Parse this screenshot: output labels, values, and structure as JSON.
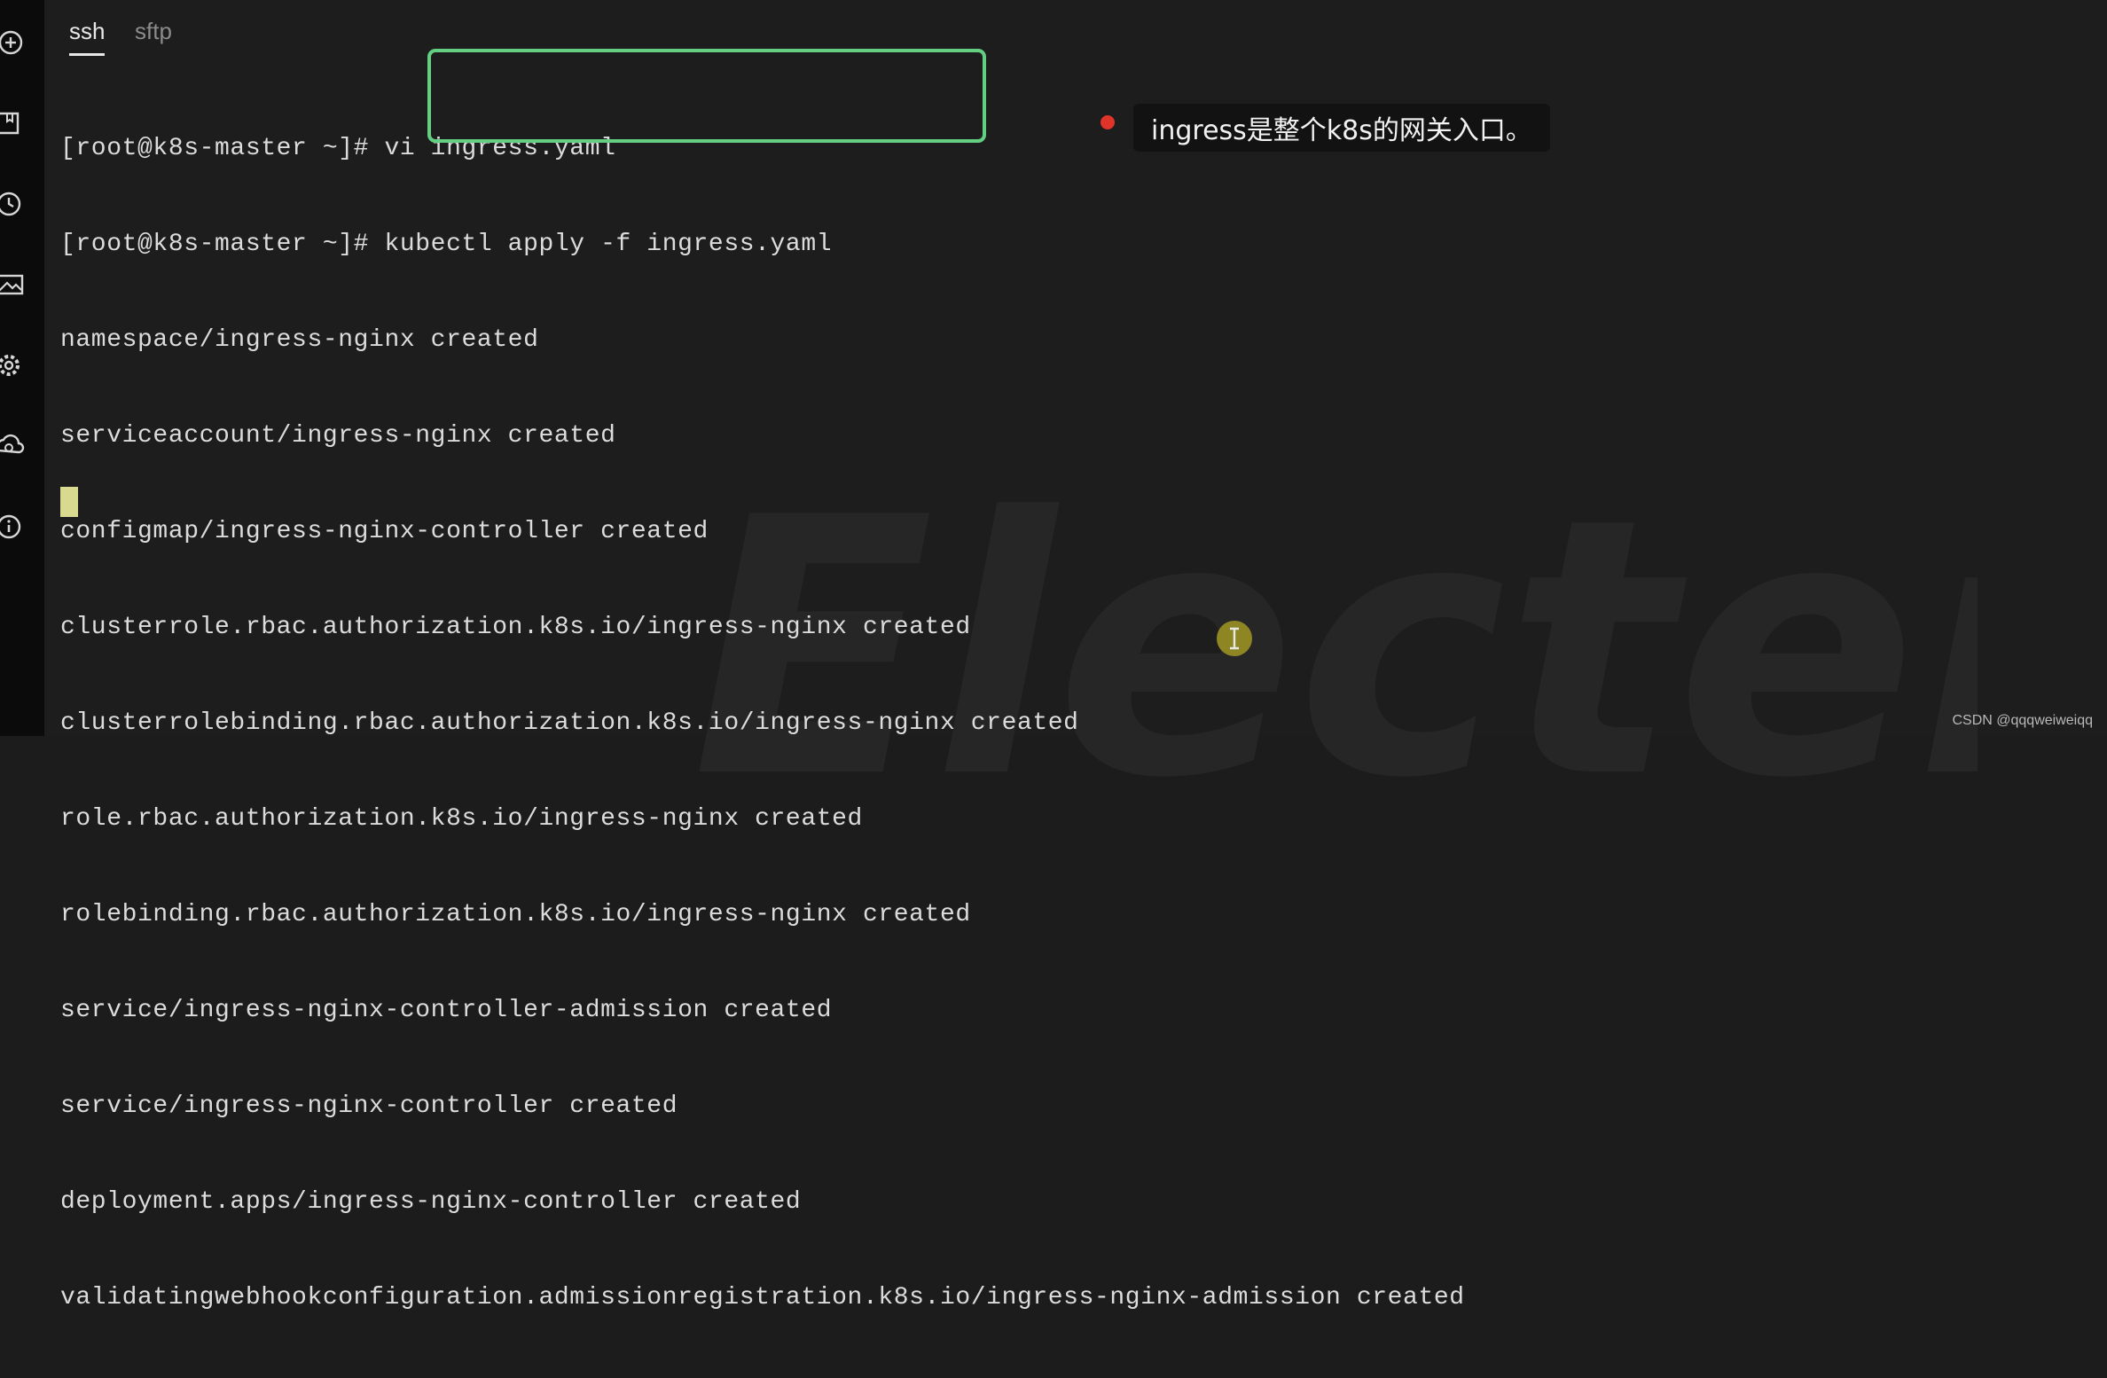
{
  "tabs": [
    {
      "label": "ssh",
      "active": true
    },
    {
      "label": "sftp",
      "active": false
    }
  ],
  "sidebar_icons": [
    "add-icon",
    "bookmark-icon",
    "history-icon",
    "image-icon",
    "settings-icon",
    "cloud-sync-icon",
    "info-icon"
  ],
  "terminal": {
    "lines": [
      "[root@k8s-master ~]# vi ingress.yaml",
      "[root@k8s-master ~]# kubectl apply -f ingress.yaml",
      "namespace/ingress-nginx created",
      "serviceaccount/ingress-nginx created",
      "configmap/ingress-nginx-controller created",
      "clusterrole.rbac.authorization.k8s.io/ingress-nginx created",
      "clusterrolebinding.rbac.authorization.k8s.io/ingress-nginx created",
      "role.rbac.authorization.k8s.io/ingress-nginx created",
      "rolebinding.rbac.authorization.k8s.io/ingress-nginx created",
      "service/ingress-nginx-controller-admission created",
      "service/ingress-nginx-controller created",
      "deployment.apps/ingress-nginx-controller created",
      "validatingwebhookconfiguration.admissionregistration.k8s.io/ingress-nginx-admission created"
    ]
  },
  "watermark": "Electerm",
  "annotation": {
    "text": "ingress是整个k8s的网关入口。",
    "dot_color": "#e0342a"
  },
  "highlight_color": "#64cf83",
  "credit": "CSDN @qqqweiweiqq"
}
